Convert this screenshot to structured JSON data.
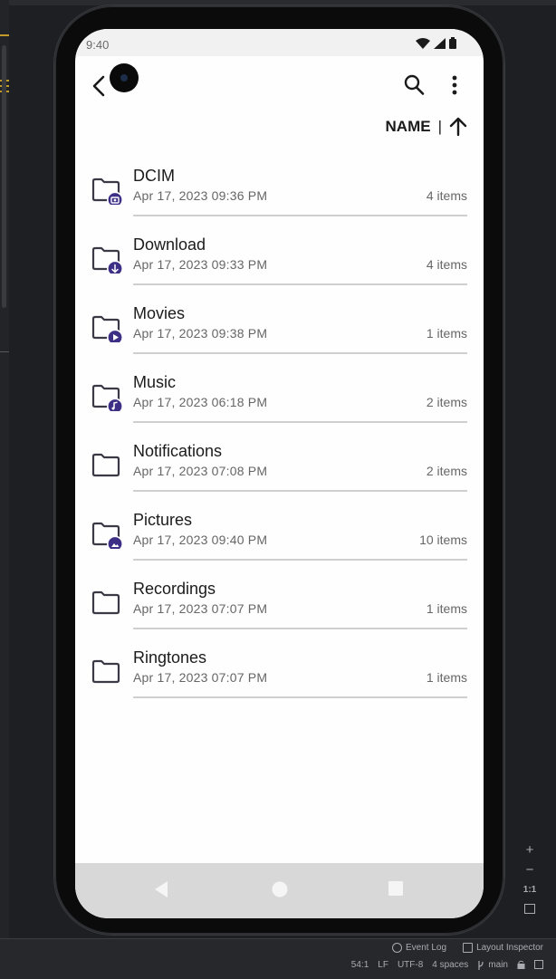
{
  "status_bar": {
    "time": "9:40"
  },
  "sort": {
    "label": "NAME",
    "separator": "|"
  },
  "folders": [
    {
      "name": "DCIM",
      "date": "Apr 17, 2023 09:36 PM",
      "count": "4 items",
      "badge": "camera"
    },
    {
      "name": "Download",
      "date": "Apr 17, 2023 09:33 PM",
      "count": "4 items",
      "badge": "download"
    },
    {
      "name": "Movies",
      "date": "Apr 17, 2023 09:38 PM",
      "count": "1 items",
      "badge": "play"
    },
    {
      "name": "Music",
      "date": "Apr 17, 2023 06:18 PM",
      "count": "2 items",
      "badge": "music"
    },
    {
      "name": "Notifications",
      "date": "Apr 17, 2023 07:08 PM",
      "count": "2 items",
      "badge": ""
    },
    {
      "name": "Pictures",
      "date": "Apr 17, 2023 09:40 PM",
      "count": "10 items",
      "badge": "image"
    },
    {
      "name": "Recordings",
      "date": "Apr 17, 2023 07:07 PM",
      "count": "1 items",
      "badge": ""
    },
    {
      "name": "Ringtones",
      "date": "Apr 17, 2023 07:07 PM",
      "count": "1 items",
      "badge": ""
    }
  ],
  "ide": {
    "event_log": "Event Log",
    "layout_inspector": "Layout Inspector",
    "cursor_pos": "54:1",
    "line_sep": "LF",
    "encoding": "UTF-8",
    "indent": "4 spaces",
    "branch": "main",
    "zoom_in": "+",
    "zoom_out": "−",
    "zoom_actual": "1:1"
  },
  "colors": {
    "badge": "#3d2f86",
    "folder_stroke": "#3a3a46",
    "nav_bg": "#d8d8d9"
  }
}
